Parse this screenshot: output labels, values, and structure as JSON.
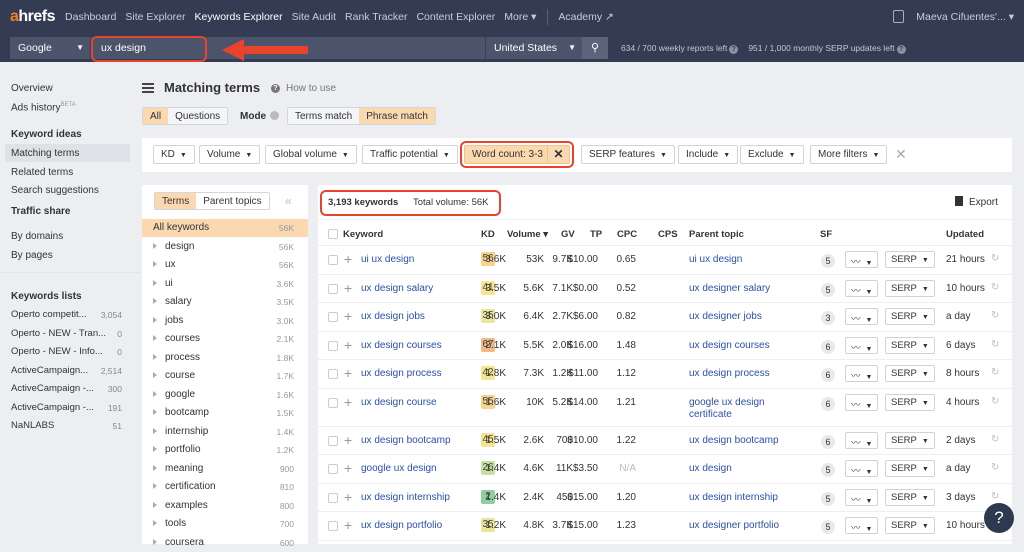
{
  "nav": {
    "logo_a": "a",
    "logo_rest": "hrefs",
    "items": [
      "Dashboard",
      "Site Explorer",
      "Keywords Explorer",
      "Site Audit",
      "Rank Tracker",
      "Content Explorer",
      "More ▾"
    ],
    "active": "Keywords Explorer",
    "academy": "Academy ↗",
    "user": "Maeva Cifuentes'...  ▾"
  },
  "search": {
    "engine": "Google",
    "query": "ux design",
    "country": "United States",
    "weekly": "634 / 700 weekly reports left",
    "monthly": "951 / 1,000 monthly SERP updates left"
  },
  "sidebar": {
    "overview": "Overview",
    "ads": "Ads history",
    "beta": "BETA",
    "ideas_h": "Keyword ideas",
    "ideas": [
      "Matching terms",
      "Related terms",
      "Search suggestions"
    ],
    "traffic_h": "Traffic share",
    "traffic": [
      "By domains",
      "By pages"
    ],
    "lists_h": "Keywords lists",
    "lists": [
      {
        "name": "Operto competit...",
        "count": "3,054"
      },
      {
        "name": "Operto - NEW - Tran...",
        "count": "0"
      },
      {
        "name": "Operto - NEW - Info...",
        "count": "0"
      },
      {
        "name": "ActiveCampaign...",
        "count": "2,514"
      },
      {
        "name": "ActiveCampaign -...",
        "count": "300"
      },
      {
        "name": "ActiveCampaign -...",
        "count": "191"
      },
      {
        "name": "NaNLABS",
        "count": "51"
      }
    ]
  },
  "main": {
    "title": "Matching terms",
    "how": "How to use",
    "type_tabs": [
      "All",
      "Questions"
    ],
    "mode_label": "Mode",
    "mode_tabs": [
      "Terms match",
      "Phrase match"
    ],
    "filters": [
      "KD",
      "Volume",
      "Global volume",
      "Traffic potential"
    ],
    "active_filter": "Word count: 3-3",
    "filters2": [
      "SERP features",
      "Include",
      "Exclude",
      "More filters"
    ]
  },
  "terms": {
    "tabs": [
      "Terms",
      "Parent topics"
    ],
    "all": {
      "name": "All keywords",
      "vol": "56K"
    },
    "items": [
      [
        "design",
        "56K"
      ],
      [
        "ux",
        "56K"
      ],
      [
        "ui",
        "3.6K"
      ],
      [
        "salary",
        "3.5K"
      ],
      [
        "jobs",
        "3.0K"
      ],
      [
        "courses",
        "2.1K"
      ],
      [
        "process",
        "1.8K"
      ],
      [
        "course",
        "1.7K"
      ],
      [
        "google",
        "1.6K"
      ],
      [
        "bootcamp",
        "1.5K"
      ],
      [
        "internship",
        "1.4K"
      ],
      [
        "portfolio",
        "1.2K"
      ],
      [
        "meaning",
        "900"
      ],
      [
        "certification",
        "810"
      ],
      [
        "examples",
        "800"
      ],
      [
        "tools",
        "700"
      ],
      [
        "coursera",
        "600"
      ]
    ]
  },
  "results": {
    "count": "3,193 keywords",
    "total": "Total volume: 56K",
    "export": "Export",
    "headers": [
      "Keyword",
      "KD",
      "Volume ▾",
      "GV",
      "TP",
      "CPC",
      "CPS",
      "Parent topic",
      "SF",
      "Updated"
    ],
    "serp_label": "SERP",
    "rows": [
      [
        "ui ux design",
        "56",
        "3.6K",
        "53K",
        "9.7K",
        "$10.00",
        "0.65",
        "ui ux design",
        "5",
        "21 hours"
      ],
      [
        "ux design salary",
        "41",
        "3.5K",
        "5.6K",
        "7.1K",
        "$0.00",
        "0.52",
        "ux designer salary",
        "5",
        "10 hours"
      ],
      [
        "ux design jobs",
        "35",
        "3.0K",
        "6.4K",
        "2.7K",
        "$6.00",
        "0.82",
        "ux designer jobs",
        "3",
        "a day"
      ],
      [
        "ux design courses",
        "67",
        "2.1K",
        "5.5K",
        "2.0K",
        "$16.00",
        "1.48",
        "ux design courses",
        "6",
        "6 days"
      ],
      [
        "ux design process",
        "42",
        "1.8K",
        "7.3K",
        "1.2K",
        "$11.00",
        "1.12",
        "ux design process",
        "6",
        "8 hours"
      ],
      [
        "ux design course",
        "55",
        "1.6K",
        "10K",
        "5.2K",
        "$14.00",
        "1.21",
        "google ux design certificate",
        "6",
        "4 hours"
      ],
      [
        "ux design bootcamp",
        "45",
        "1.5K",
        "2.6K",
        "700",
        "$10.00",
        "1.22",
        "ux design bootcamp",
        "6",
        "2 days"
      ],
      [
        "google ux design",
        "26",
        "1.4K",
        "4.6K",
        "11K",
        "$3.50",
        "N/A",
        "ux design",
        "5",
        "a day"
      ],
      [
        "ux design internship",
        "2",
        "1.4K",
        "2.4K",
        "450",
        "$15.00",
        "1.20",
        "ux design internship",
        "5",
        "3 days"
      ],
      [
        "ux design portfolio",
        "35",
        "1.2K",
        "4.8K",
        "3.7K",
        "$15.00",
        "1.23",
        "ux designer portfolio",
        "5",
        "10 hours"
      ]
    ]
  },
  "colors": {
    "nav": "#343c53",
    "accent": "#f57b20",
    "highlight": "#e8432c",
    "selected": "#fbd9b0",
    "link": "#2b4fb0"
  },
  "help": "?"
}
